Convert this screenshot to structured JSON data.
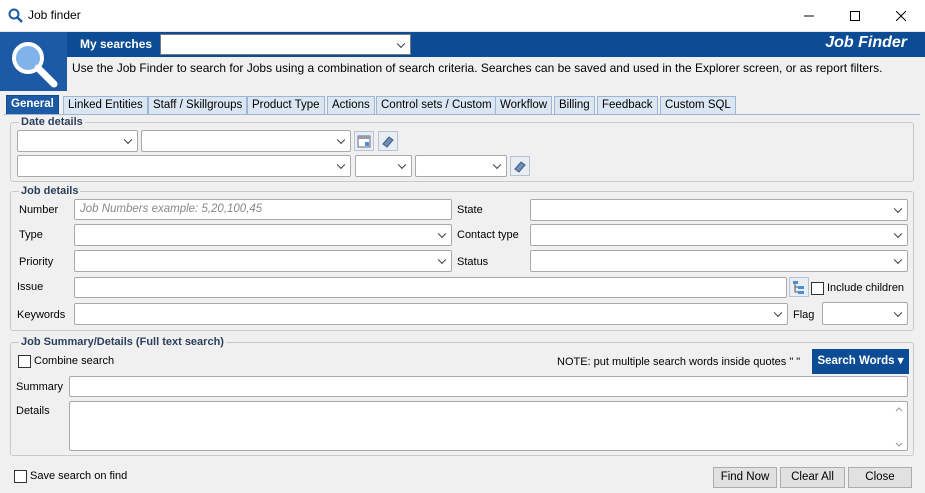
{
  "window": {
    "title": "Job finder",
    "controls": [
      "minimize",
      "maximize",
      "close"
    ]
  },
  "header": {
    "my_searches_label": "My searches",
    "my_searches_value": "",
    "brand": "Job Finder",
    "description": "Use the Job Finder to search for Jobs using a combination of search criteria.  Searches can be saved and used in the Explorer screen, or as report filters."
  },
  "tabs": [
    {
      "label": "General",
      "active": true
    },
    {
      "label": "Linked Entities"
    },
    {
      "label": "Staff / Skillgroups"
    },
    {
      "label": "Product Type"
    },
    {
      "label": "Actions"
    },
    {
      "label": "Control sets / Custom"
    },
    {
      "label": "Workflow"
    },
    {
      "label": "Billing"
    },
    {
      "label": "Feedback"
    },
    {
      "label": "Custom SQL"
    }
  ],
  "date_details": {
    "title": "Date details"
  },
  "job_details": {
    "title": "Job details",
    "number_label": "Number",
    "number_placeholder": "Job Numbers example: 5,20,100,45",
    "type_label": "Type",
    "priority_label": "Priority",
    "issue_label": "Issue",
    "keywords_label": "Keywords",
    "state_label": "State",
    "contact_type_label": "Contact type",
    "status_label": "Status",
    "include_children_label": "Include children",
    "flag_label": "Flag"
  },
  "fulltext": {
    "title": "Job Summary/Details (Full text search)",
    "combine_label": "Combine search",
    "note": "NOTE: put multiple search words inside quotes \" \"",
    "search_words_button": "Search Words",
    "summary_label": "Summary",
    "details_label": "Details"
  },
  "footer": {
    "save_search_label": "Save search on find",
    "find_now": "Find Now",
    "clear_all": "Clear All",
    "close": "Close"
  },
  "colors": {
    "brand_blue": "#0b4c95",
    "logo_blue": "#1c5aa6",
    "tab_bg": "#dbe6f3"
  }
}
